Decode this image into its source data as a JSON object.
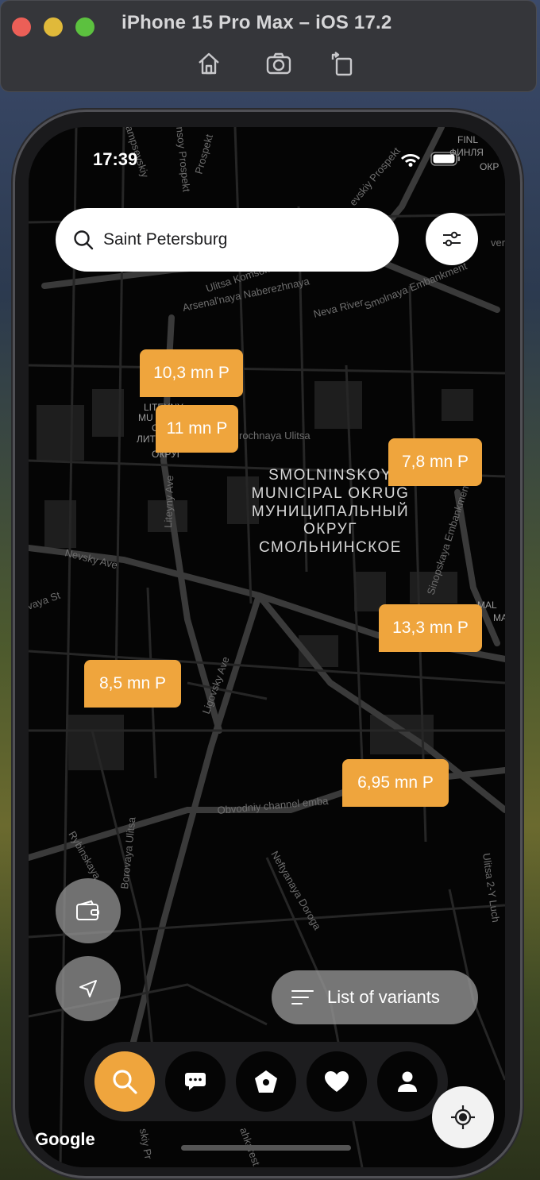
{
  "window": {
    "title": "iPhone 15 Pro Max – iOS 17.2",
    "toolbar_icons": [
      "home-icon",
      "screenshot-icon",
      "rotate-icon"
    ]
  },
  "status_bar": {
    "time": "17:39",
    "icons": [
      "wifi-icon",
      "battery-icon"
    ]
  },
  "search": {
    "value": "Saint Petersburg",
    "icon": "search-icon"
  },
  "filter_icon": "sliders-icon",
  "map": {
    "streets": [
      "Ulitsa Komsomola",
      "Arsenal'naya Naberezhnaya",
      "Neva River",
      "Smolnaya Embankment",
      "Nevsky Ave",
      "Liteyny Ave",
      "Ligovsky Ave",
      "Obvodniy channel emba",
      "Neftyanaya Doroga",
      "Borovaya Ulitsa",
      "Rybinskaya",
      "Ulitsa 2-Y Luch",
      "rochnaya Ulitsa",
      "Sinopskaya Embankment",
      "Prospekt",
      "nsoy Prospekt",
      "ampsevskiy",
      "evskiy Prospekt",
      "verdl",
      "vaya St",
      "ahkarest",
      "skiy Pr"
    ],
    "district_label": [
      "SMOLNINSKOY",
      "MUNICIPAL OKRUG",
      "МУНИЦИПАЛЬНЫЙ",
      "ОКРУГ",
      "СМОЛЬНИНСКОЕ"
    ],
    "corner_labels": [
      "FINL",
      "ФИНЛЯ",
      "ОКР",
      "MAL",
      "MA"
    ],
    "small_labels": [
      "LITEYNY",
      "MU",
      "O",
      "ЛИТ",
      "ОКРУГ"
    ]
  },
  "prices": [
    {
      "label": "10,3 mn P"
    },
    {
      "label": "11 mn P"
    },
    {
      "label": "7,8 mn P"
    },
    {
      "label": "13,3 mn P"
    },
    {
      "label": "8,5 mn P"
    },
    {
      "label": "6,95 mn P"
    }
  ],
  "side_buttons": [
    "wallet-icon",
    "navigation-icon"
  ],
  "list_button": {
    "label": "List of variants",
    "icon": "list-icon"
  },
  "tabs": [
    {
      "icon": "search-icon",
      "active": true
    },
    {
      "icon": "chat-icon",
      "active": false
    },
    {
      "icon": "home-icon",
      "active": false
    },
    {
      "icon": "heart-icon",
      "active": false
    },
    {
      "icon": "profile-icon",
      "active": false
    }
  ],
  "locate_icon": "crosshair-icon",
  "google_logo": "Google",
  "colors": {
    "accent": "#efa53d",
    "map_bg": "#050505",
    "roads": "#3a3a3a"
  }
}
